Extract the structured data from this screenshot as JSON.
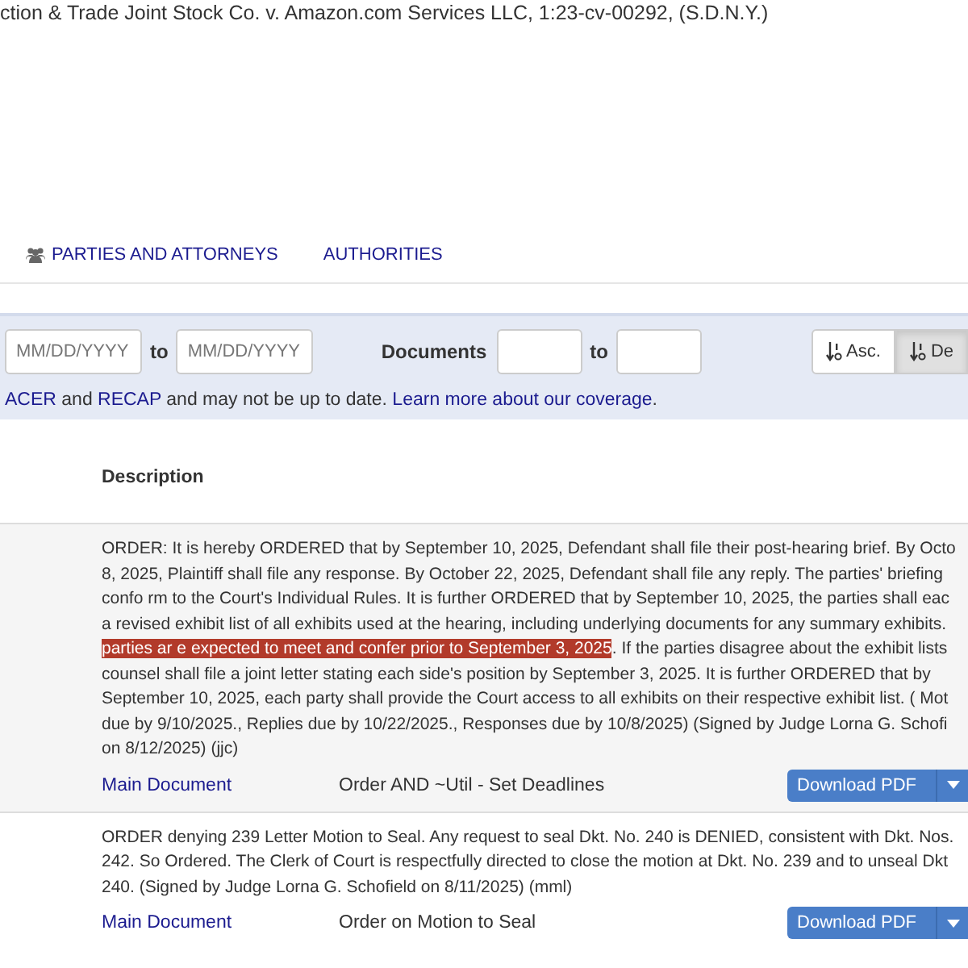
{
  "case_title": "ction & Trade Joint Stock Co. v. Amazon.com Services LLC, 1:23-cv-00292, (S.D.N.Y.)",
  "tabs": [
    {
      "label": "PARTIES AND ATTORNEYS",
      "selected": false
    },
    {
      "label": "AUTHORITIES",
      "selected": false
    }
  ],
  "filters": {
    "date_from": {
      "placeholder": "MM/DD/YYYY"
    },
    "date_sep": "to",
    "date_to": {
      "placeholder": "MM/DD/YYYY"
    },
    "documents_label": "Documents",
    "doc_sep": "to",
    "sort": [
      {
        "label": "Asc.",
        "selected": false
      },
      {
        "label": "De",
        "selected": true
      }
    ]
  },
  "notice": [
    {
      "text": "ACER",
      "link": true
    },
    {
      "text": " and ",
      "link": false
    },
    {
      "text": "RECAP",
      "link": true
    },
    {
      "text": " and may not be up to date. ",
      "link": false
    },
    {
      "text": "Learn more about our coverage",
      "link": true
    },
    {
      "text": ".",
      "link": false
    }
  ],
  "table": {
    "columns": [
      "Description"
    ],
    "entries": [
      {
        "lines": [
          [
            {
              "text": "ORDER: It is hereby ORDERED that by September 10, 2025, Defendant shall file their post-hearing brief. By Octo",
              "highlighted": false
            }
          ],
          [
            {
              "text": "8, 2025, Plaintiff shall file any response. By October 22, 2025, Defendant shall file any reply. The parties' briefing",
              "highlighted": false
            }
          ],
          [
            {
              "text": "confo rm to the Court's Individual Rules. It is further ORDERED that by September 10, 2025, the parties shall eac",
              "highlighted": false
            }
          ],
          [
            {
              "text": "a revised exhibit list of all exhibits used at the hearing, including underlying documents for any summary exhibits.",
              "highlighted": false
            }
          ],
          [
            {
              "text": "parties ar e expected to meet and confer prior to September 3, 2025",
              "highlighted": true
            },
            {
              "text": ". If the parties disagree about the exhibit lists",
              "highlighted": false
            }
          ],
          [
            {
              "text": "counsel shall file a joint letter stating each side's position by September 3, 2025. It is further ORDERED that by",
              "highlighted": false
            }
          ],
          [
            {
              "text": "September 10, 2025, each party shall provide the Court access to all exhibits on their respective exhibit list. ( Mot",
              "highlighted": false
            }
          ],
          [
            {
              "text": "due by 9/10/2025., Replies due by 10/22/2025., Responses due by 10/8/2025) (Signed by Judge Lorna G. Schofi",
              "highlighted": false
            }
          ],
          [
            {
              "text": "on 8/12/2025) (jjc)",
              "highlighted": false
            }
          ]
        ],
        "document_link": "Main Document",
        "document_type": "Order AND ~Util - Set Deadlines",
        "download": "Download PDF"
      },
      {
        "lines": [
          [
            {
              "text": "ORDER denying 239 Letter Motion to Seal. Any request to seal Dkt. No. 240 is DENIED, consistent with Dkt. Nos.",
              "highlighted": false
            }
          ],
          [
            {
              "text": "242. So Ordered. The Clerk of Court is respectfully directed to close the motion at Dkt. No. 239 and to unseal Dkt",
              "highlighted": false
            }
          ],
          [
            {
              "text": "240. (Signed by Judge Lorna G. Schofield on 8/11/2025) (mml)",
              "highlighted": false
            }
          ]
        ],
        "document_link": "Main Document",
        "document_type": "Order on Motion to Seal",
        "download": "Download PDF"
      }
    ]
  }
}
